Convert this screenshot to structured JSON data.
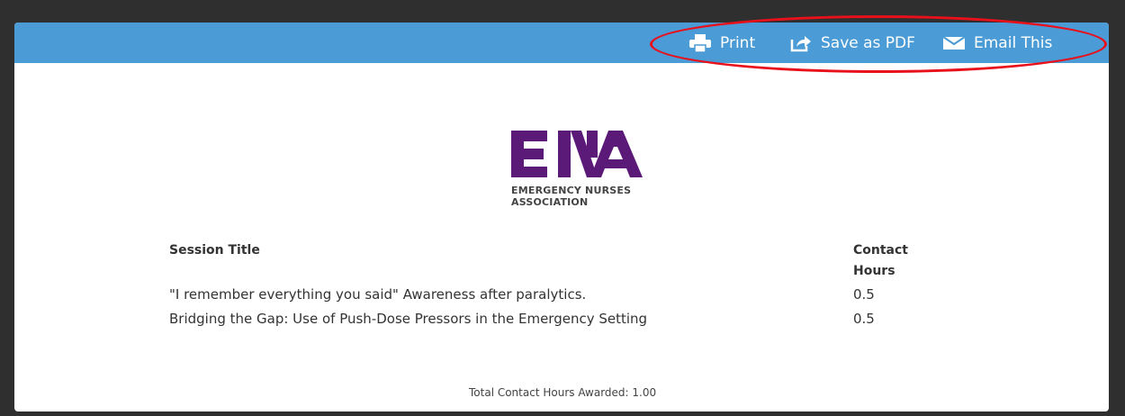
{
  "toolbar": {
    "print_label": "Print",
    "save_pdf_label": "Save as PDF",
    "email_label": "Email This"
  },
  "logo": {
    "mark": "ENA",
    "line1": "EMERGENCY NURSES",
    "line2": "ASSOCIATION",
    "color": "#5b1a78"
  },
  "table": {
    "headers": {
      "title": "Session Title",
      "hours_line1": "Contact",
      "hours_line2": "Hours"
    },
    "rows": [
      {
        "title": "\"I remember everything you said\" Awareness after paralytics.",
        "hours": "0.5"
      },
      {
        "title": "Bridging the Gap: Use of Push-Dose Pressors in the Emergency Setting",
        "hours": "0.5"
      }
    ]
  },
  "total": "Total Contact Hours Awarded: 1.00",
  "colors": {
    "toolbar": "#4a9bd6",
    "highlight": "#e8101b",
    "background": "#2f2f2f"
  }
}
